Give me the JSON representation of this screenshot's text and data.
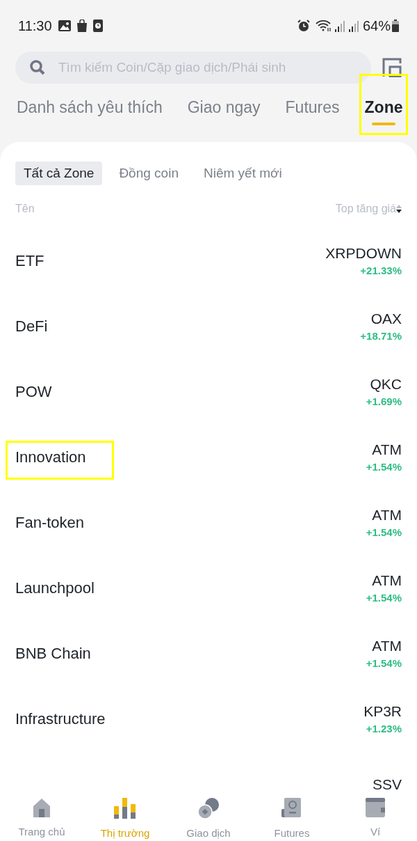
{
  "status_bar": {
    "time": "11:30",
    "battery": "64%"
  },
  "search": {
    "placeholder": "Tìm kiếm Coin/Cặp giao dịch/Phái sinh"
  },
  "tabs": [
    {
      "label": "Danh sách yêu thích",
      "selected": false,
      "highlighted": false
    },
    {
      "label": "Giao ngay",
      "selected": false,
      "highlighted": false
    },
    {
      "label": "Futures",
      "selected": false,
      "highlighted": false
    },
    {
      "label": "Zone",
      "selected": true,
      "highlighted": true
    }
  ],
  "chips": [
    {
      "label": "Tất cả Zone",
      "selected": true
    },
    {
      "label": "Đồng coin",
      "selected": false
    },
    {
      "label": "Niêm yết mới",
      "selected": false
    }
  ],
  "columns": {
    "name": "Tên",
    "sort": "Top tăng giá"
  },
  "rows": [
    {
      "name": "ETF",
      "pair": "XRPDOWN",
      "change": "+21.33%",
      "highlighted": false
    },
    {
      "name": "DeFi",
      "pair": "OAX",
      "change": "+18.71%",
      "highlighted": false
    },
    {
      "name": "POW",
      "pair": "QKC",
      "change": "+1.69%",
      "highlighted": false
    },
    {
      "name": "Innovation",
      "pair": "ATM",
      "change": "+1.54%",
      "highlighted": true
    },
    {
      "name": "Fan-token",
      "pair": "ATM",
      "change": "+1.54%",
      "highlighted": false
    },
    {
      "name": "Launchpool",
      "pair": "ATM",
      "change": "+1.54%",
      "highlighted": false
    },
    {
      "name": "BNB Chain",
      "pair": "ATM",
      "change": "+1.54%",
      "highlighted": false
    },
    {
      "name": "Infrastructure",
      "pair": "KP3R",
      "change": "+1.23%",
      "highlighted": false
    },
    {
      "pair": "SSV",
      "highlighted": false
    }
  ],
  "nav": [
    {
      "label": "Trang chủ",
      "kind": "home",
      "selected": false
    },
    {
      "label": "Thị trường",
      "kind": "markets",
      "selected": true
    },
    {
      "label": "Giao dịch",
      "kind": "trade",
      "selected": false
    },
    {
      "label": "Futures",
      "kind": "futures",
      "selected": false
    },
    {
      "label": "Ví",
      "kind": "wallet",
      "selected": false
    }
  ]
}
